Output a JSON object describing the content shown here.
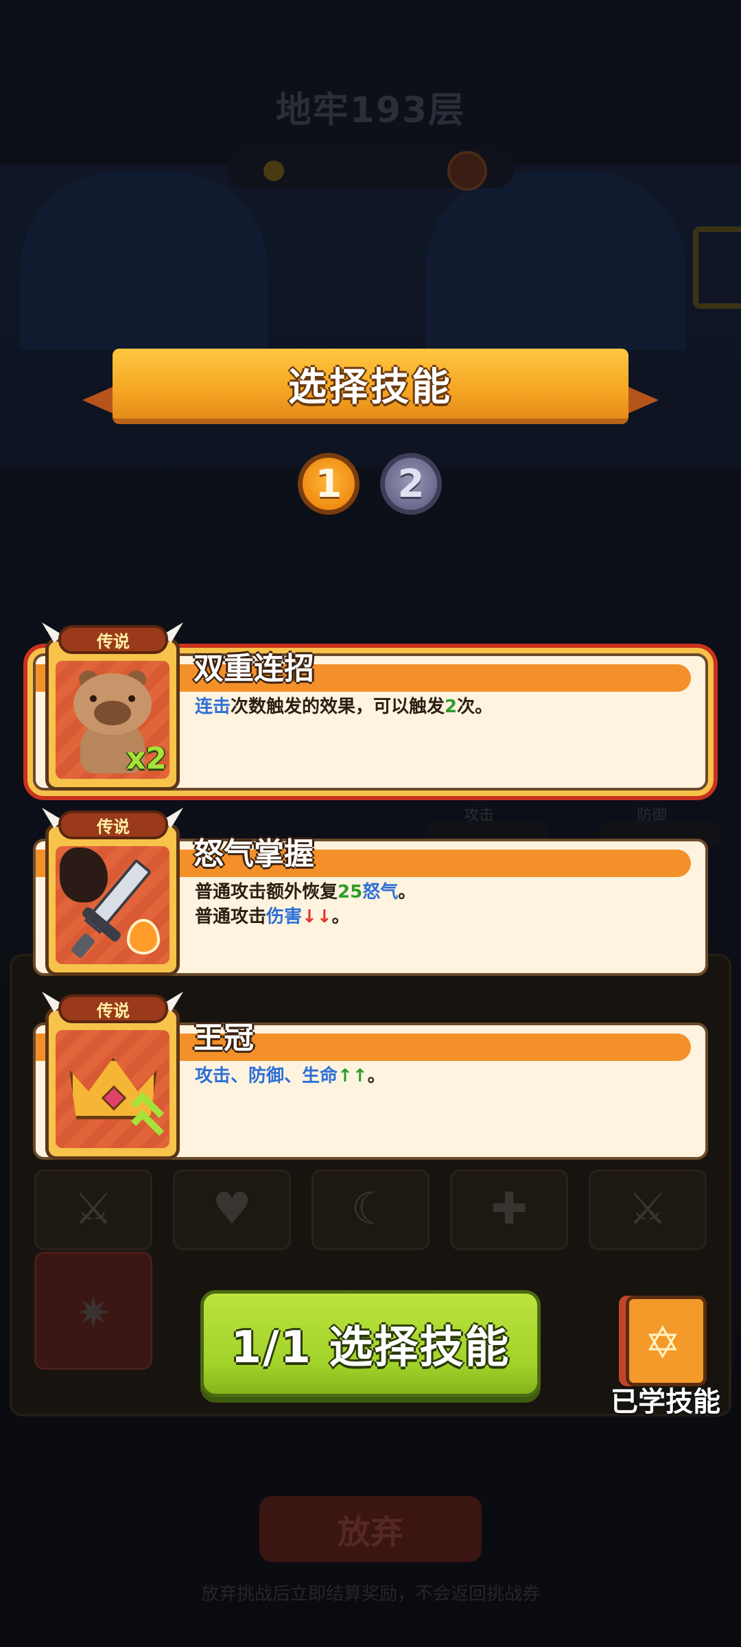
{
  "background": {
    "dungeon_title": "地牢193层",
    "stat_attack_label": "攻击",
    "stat_defense_label": "防御",
    "abandon_button": "放弃",
    "abandon_note": "放弃挑战后立即结算奖励，不会返回挑战券"
  },
  "header": {
    "title": "选择技能"
  },
  "steps": [
    {
      "label": "1",
      "state": "active"
    },
    {
      "label": "2",
      "state": "inactive"
    }
  ],
  "skills": [
    {
      "rarity": "传说",
      "name": "双重连招",
      "icon": "capybara-x2-icon",
      "badge": "x2",
      "selected": true,
      "desc_lines": [
        [
          {
            "t": "连击",
            "c": "blue"
          },
          {
            "t": "次数触发的效果，可以触发",
            "c": ""
          },
          {
            "t": "2",
            "c": "green"
          },
          {
            "t": "次。",
            "c": ""
          }
        ]
      ]
    },
    {
      "rarity": "传说",
      "name": "怒气掌握",
      "icon": "sword-flame-icon",
      "selected": false,
      "desc_lines": [
        [
          {
            "t": "普通攻击额外恢复",
            "c": ""
          },
          {
            "t": "25",
            "c": "green"
          },
          {
            "t": "怒气",
            "c": "blue"
          },
          {
            "t": "。",
            "c": ""
          }
        ],
        [
          {
            "t": "普通攻击",
            "c": ""
          },
          {
            "t": "伤害",
            "c": "blue"
          },
          {
            "t": "↓↓",
            "c": "red"
          },
          {
            "t": "。",
            "c": ""
          }
        ]
      ]
    },
    {
      "rarity": "传说",
      "name": "王冠",
      "icon": "crown-icon",
      "selected": false,
      "desc_lines": [
        [
          {
            "t": "攻击、防御、生命",
            "c": "blue"
          },
          {
            "t": "↑↑",
            "c": "green"
          },
          {
            "t": "。",
            "c": ""
          }
        ]
      ]
    }
  ],
  "confirm_button": "1/1 选择技能",
  "learned_skills_label": "已学技能",
  "colors": {
    "banner": "#f5a623",
    "confirm": "#a2d32a",
    "keyword_blue": "#2c6fd6",
    "keyword_green": "#2e9c2a",
    "arrow_red": "#e0322a"
  }
}
